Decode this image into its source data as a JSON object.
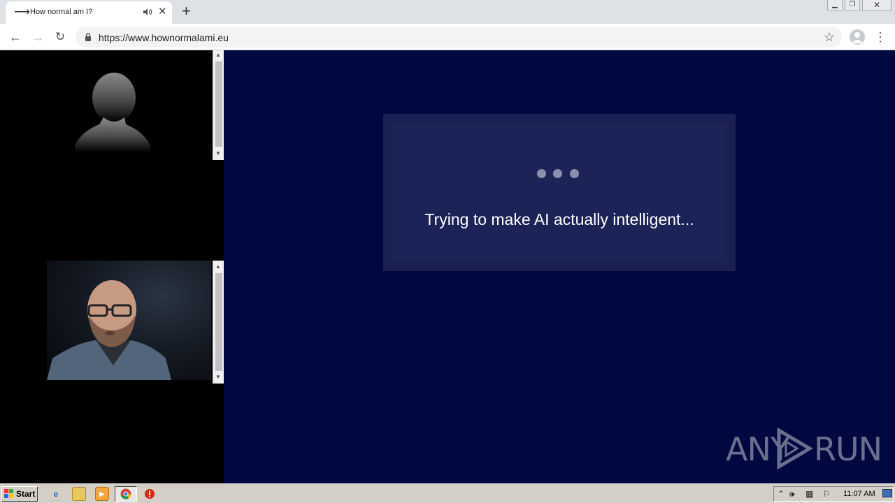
{
  "browser": {
    "tab_title": "How normal am I?",
    "url": "https://www.hownormalami.eu",
    "window_controls": {
      "minimize_icon": "minimize-icon",
      "restore_icon": "restore-icon",
      "close_icon": "close-icon"
    }
  },
  "main": {
    "loading_text": "Trying to make AI actually intelligent...",
    "watermark_left": "ANY",
    "watermark_right": "RUN"
  },
  "taskbar": {
    "start_label": "Start",
    "clock": "11:07 AM"
  },
  "colors": {
    "main_bg": "#000840",
    "card_bg": "#1a2152",
    "dot": "#8a8fad"
  }
}
